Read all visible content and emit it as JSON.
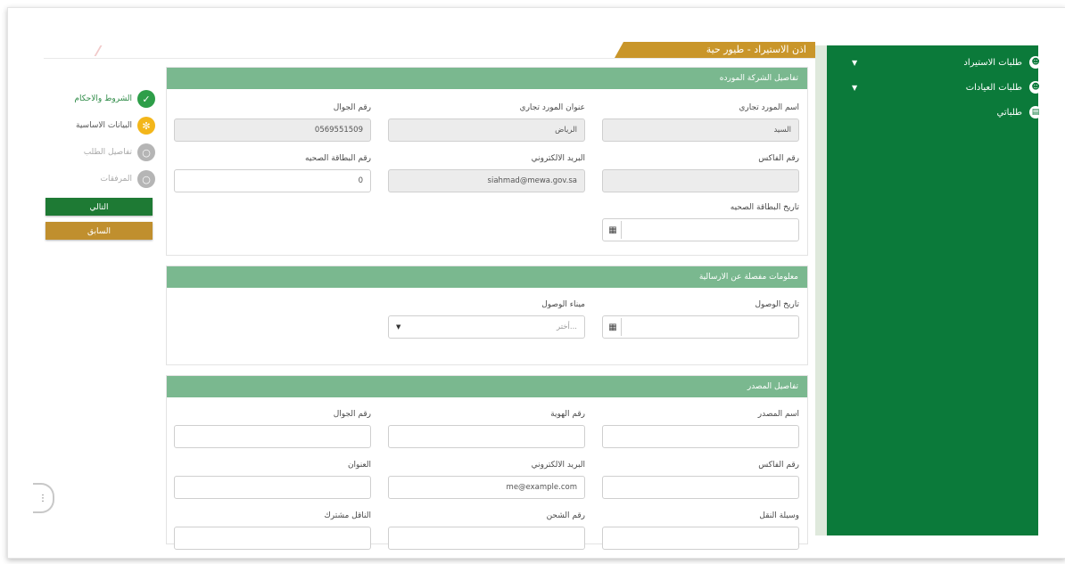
{
  "header": {
    "title": "اذن الاستيراد - طيور حية"
  },
  "sidebar": {
    "items": [
      {
        "label": "طلبات الاستيراد",
        "icon": "user-add-icon",
        "has_caret": true
      },
      {
        "label": "طلبات العيادات",
        "icon": "user-add-icon",
        "has_caret": true
      },
      {
        "label": "طلباتي",
        "icon": "clipboard-icon",
        "has_caret": false
      }
    ]
  },
  "steps": [
    {
      "label": "الشروط والاحكام",
      "state": "done"
    },
    {
      "label": "البيانات الاساسية",
      "state": "current"
    },
    {
      "label": "تفاصيل الطلب",
      "state": "pending"
    },
    {
      "label": "المرفقات",
      "state": "pending"
    }
  ],
  "buttons": {
    "next": "التالي",
    "prev": "السابق"
  },
  "supplier": {
    "title": "تفاصيل الشركة المورده",
    "fields": {
      "name_label": "اسم المورد تجاري",
      "name_value": "السيد",
      "address_label": "عنوان المورد تجاري",
      "address_value": "الرياض",
      "mobile_label": "رقم الجوال",
      "mobile_value": "0569551509",
      "fax_label": "رقم الفاكس",
      "fax_value": "",
      "email_label": "البريد الالكتروني",
      "email_value": "siahmad@mewa.gov.sa",
      "health_card_label": "رقم البطاقة الصحيه",
      "health_card_value": "0",
      "health_card_date_label": "تاريخ البطاقة الصحيه",
      "health_card_date_value": ""
    }
  },
  "shipment": {
    "title": "معلومات مفصلة عن الارسالية",
    "arrival_date_label": "تاريخ الوصول",
    "arrival_date_value": "",
    "port_label": "ميناء الوصول",
    "port_placeholder": "أختر..."
  },
  "exporter": {
    "title": "تفاصيل المصدر",
    "name_label": "اسم المصدر",
    "id_label": "رقم الهوية",
    "mobile_label": "رقم الجوال",
    "fax_label": "رقم الفاكس",
    "email_label": "البريد الالكتروني",
    "email_placeholder": "me@example.com",
    "address_label": "العنوان",
    "transport_label": "وسيلة النقل",
    "shipment_no_label": "رقم الشحن",
    "shared_carrier_label": "الناقل مشترك"
  },
  "colors": {
    "sidebar": "#0b7a3a",
    "panel_header": "#7ab88f",
    "next_button": "#1e7a34",
    "prev_button": "#c08f2e",
    "banner": "#c9962a"
  }
}
